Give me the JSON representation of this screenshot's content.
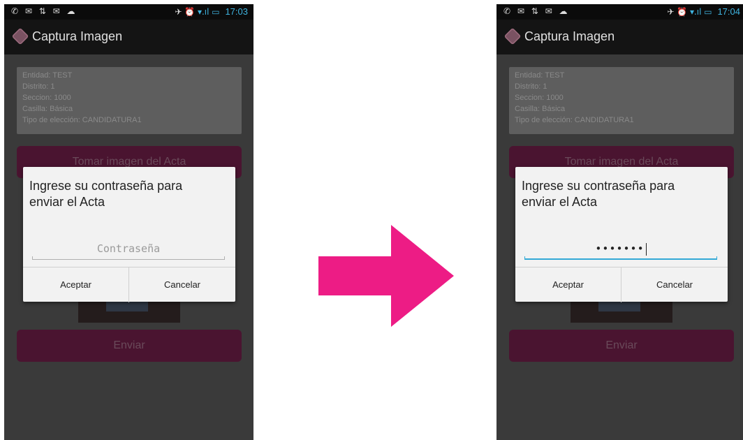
{
  "colors": {
    "arrow": "#ed1c85",
    "accent": "#33a9d6",
    "primary_button": "#4a1430"
  },
  "screens": [
    {
      "status": {
        "left_icons": "✆ ✉ ⇅ ✉ ☁",
        "right_icons": "✈ ⏰ ",
        "signal": "▾.ıl ▭",
        "time": "17:03"
      },
      "app_title": "Captura Imagen",
      "info": {
        "entidad": "Entidad: TEST",
        "distrito": "Distrito: 1",
        "seccion": "Seccion: 1000",
        "casilla": "Casilla: Básica",
        "tipo": "Tipo de elección: CANDIDATURA1"
      },
      "take_photo_label": "Tomar imagen del Acta",
      "send_label": "Enviar",
      "dialog": {
        "message": "Ingrese su contraseña para enviar el Acta",
        "password_placeholder": "Contraseña",
        "password_value": "",
        "accept_label": "Aceptar",
        "cancel_label": "Cancelar"
      }
    },
    {
      "status": {
        "left_icons": "✆ ✉ ⇅ ✉ ☁",
        "right_icons": "✈ ⏰ ",
        "signal": "▾.ıl ▭",
        "time": "17:04"
      },
      "app_title": "Captura Imagen",
      "info": {
        "entidad": "Entidad: TEST",
        "distrito": "Distrito: 1",
        "seccion": "Seccion: 1000",
        "casilla": "Casilla: Básica",
        "tipo": "Tipo de elección: CANDIDATURA1"
      },
      "take_photo_label": "Tomar imagen del Acta",
      "send_label": "Enviar",
      "dialog": {
        "message": "Ingrese su contraseña para enviar el Acta",
        "password_placeholder": "",
        "password_value": "•••••••",
        "accept_label": "Aceptar",
        "cancel_label": "Cancelar"
      }
    }
  ],
  "arrow_icon": "right-arrow-icon"
}
